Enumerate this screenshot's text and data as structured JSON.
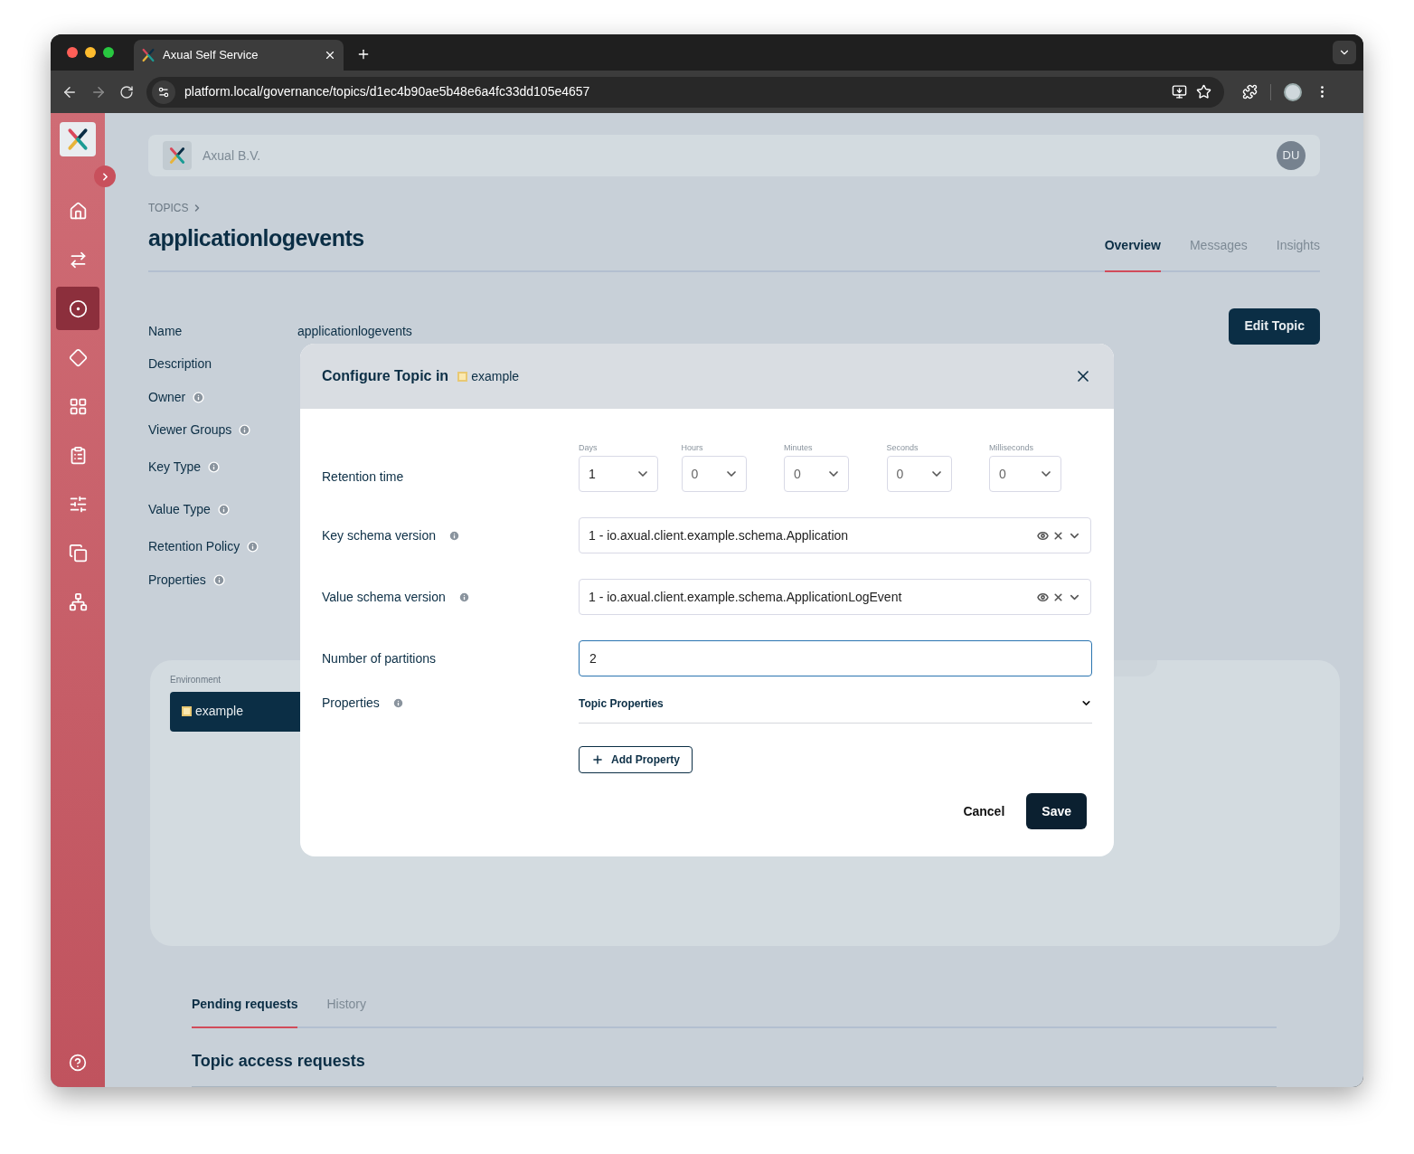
{
  "browser": {
    "tab_title": "Axual Self Service",
    "url": "platform.local/governance/topics/d1ec4b90ae5b48e6a4fc33dd105e4657"
  },
  "sidebar": {
    "items": [
      {
        "selected": false
      },
      {
        "selected": false
      },
      {
        "selected": true
      },
      {
        "selected": false
      },
      {
        "selected": false
      },
      {
        "selected": false
      },
      {
        "selected": false
      },
      {
        "selected": false
      },
      {
        "selected": false
      }
    ]
  },
  "header": {
    "organization": "Axual B.V.",
    "avatar": "DU"
  },
  "breadcrumb": "TOPICS",
  "title": "applicationlogevents",
  "tabs": [
    {
      "label": "Overview",
      "selected": true
    },
    {
      "label": "Messages",
      "selected": false
    },
    {
      "label": "Insights",
      "selected": false
    }
  ],
  "details": [
    {
      "label": "Name",
      "info": false,
      "value": "applicationlogevents"
    },
    {
      "label": "Description",
      "info": false
    },
    {
      "label": "Owner",
      "info": true
    },
    {
      "label": "Viewer Groups",
      "info": true
    },
    {
      "label": "Key Type",
      "info": true
    },
    {
      "label": "Value Type",
      "info": true
    },
    {
      "label": "Retention Policy",
      "info": true
    },
    {
      "label": "Properties",
      "info": true
    }
  ],
  "edit_button": "Edit Topic",
  "environment": {
    "label": "Environment",
    "item": "example"
  },
  "requests": {
    "tabs": [
      {
        "label": "Pending requests",
        "selected": true
      },
      {
        "label": "History",
        "selected": false
      }
    ],
    "heading": "Topic access requests"
  },
  "modal": {
    "title": "Configure Topic in",
    "environment": "example",
    "retention": {
      "label": "Retention time",
      "info": false,
      "units": [
        {
          "label": "Days",
          "value": "1"
        },
        {
          "label": "Hours",
          "value": "0"
        },
        {
          "label": "Minutes",
          "value": "0"
        },
        {
          "label": "Seconds",
          "value": "0"
        },
        {
          "label": "Milliseconds",
          "value": "0"
        }
      ]
    },
    "key_schema": {
      "label": "Key schema version",
      "info": true,
      "value": "1 - io.axual.client.example.schema.Application"
    },
    "value_schema": {
      "label": "Value schema version",
      "info": true,
      "value": "1 - io.axual.client.example.schema.ApplicationLogEvent"
    },
    "partitions": {
      "label": "Number of partitions",
      "info": false,
      "value": "2"
    },
    "properties": {
      "label": "Properties",
      "info": true,
      "section": "Topic Properties",
      "add_button": "Add Property"
    },
    "cancel_button": "Cancel",
    "save_button": "Save"
  }
}
